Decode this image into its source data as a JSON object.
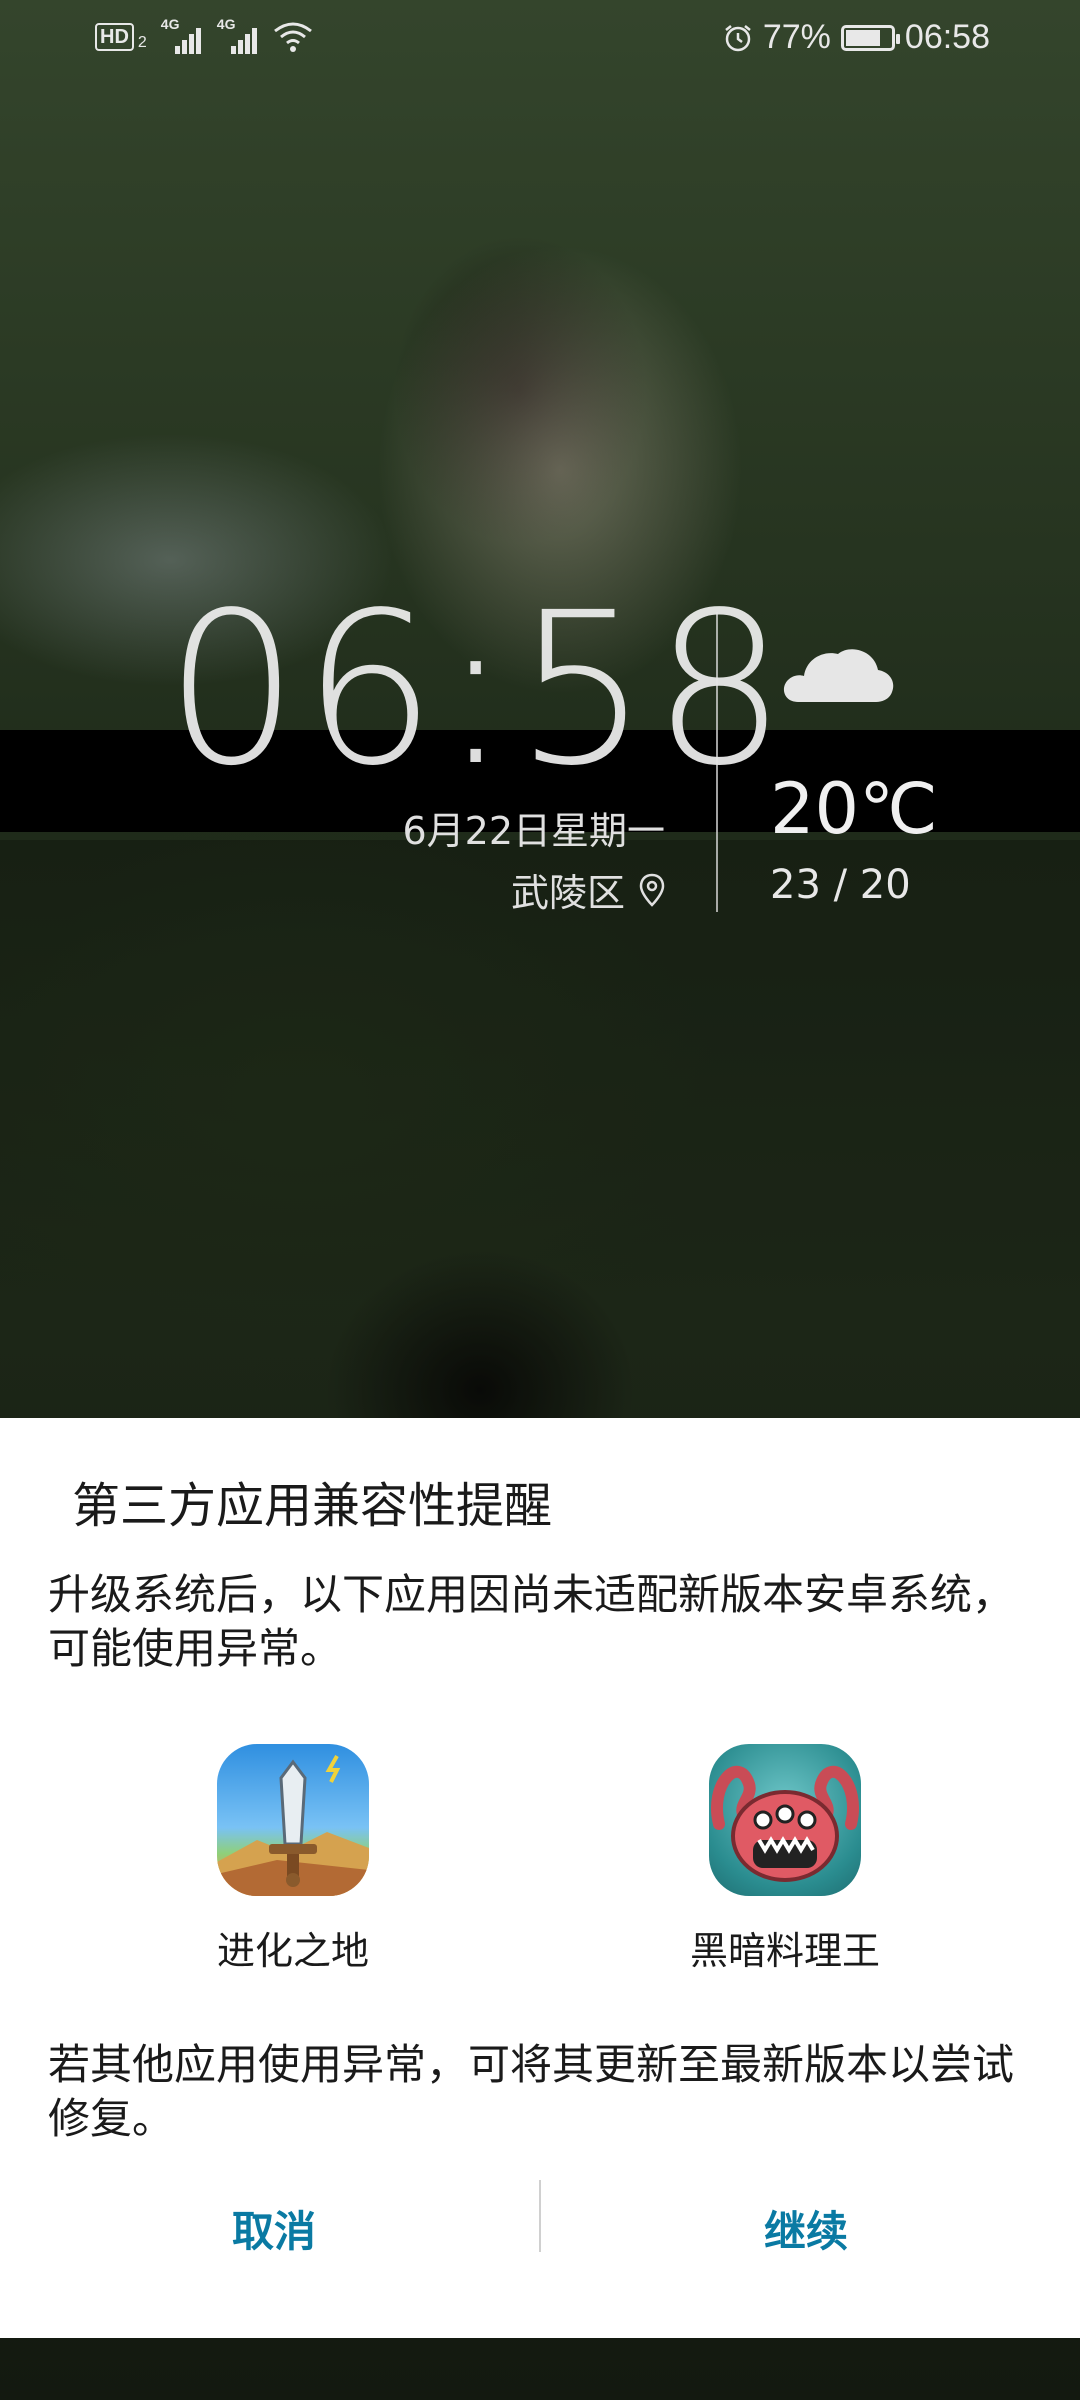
{
  "status_bar": {
    "network_hd": "HD",
    "hd_sub": "2",
    "signal1_label": "4G",
    "signal2_label": "4G",
    "icons": [
      "hd-icon",
      "signal-icon",
      "signal-icon",
      "wifi-icon",
      "alarm-icon",
      "battery-icon"
    ],
    "battery_percent": "77%",
    "battery_level": 0.77,
    "time": "06:58"
  },
  "lockscreen": {
    "clock": "06:58",
    "date": "6月22日星期一",
    "location": "武陵区",
    "weather_icon": "cloud-icon",
    "temperature": "20℃",
    "temp_range": "23 / 20"
  },
  "dialog": {
    "title": "第三方应用兼容性提醒",
    "message": "升级系统后，以下应用因尚未适配新版本安卓系统，可能使用异常。",
    "apps": [
      {
        "name": "进化之地",
        "icon": "sword-app-icon"
      },
      {
        "name": "黑暗料理王",
        "icon": "octopus-app-icon"
      }
    ],
    "note": "若其他应用使用异常，可将其更新至最新版本以尝试修复。",
    "cancel_label": "取消",
    "continue_label": "继续",
    "accent_color": "#0a7aa3"
  }
}
